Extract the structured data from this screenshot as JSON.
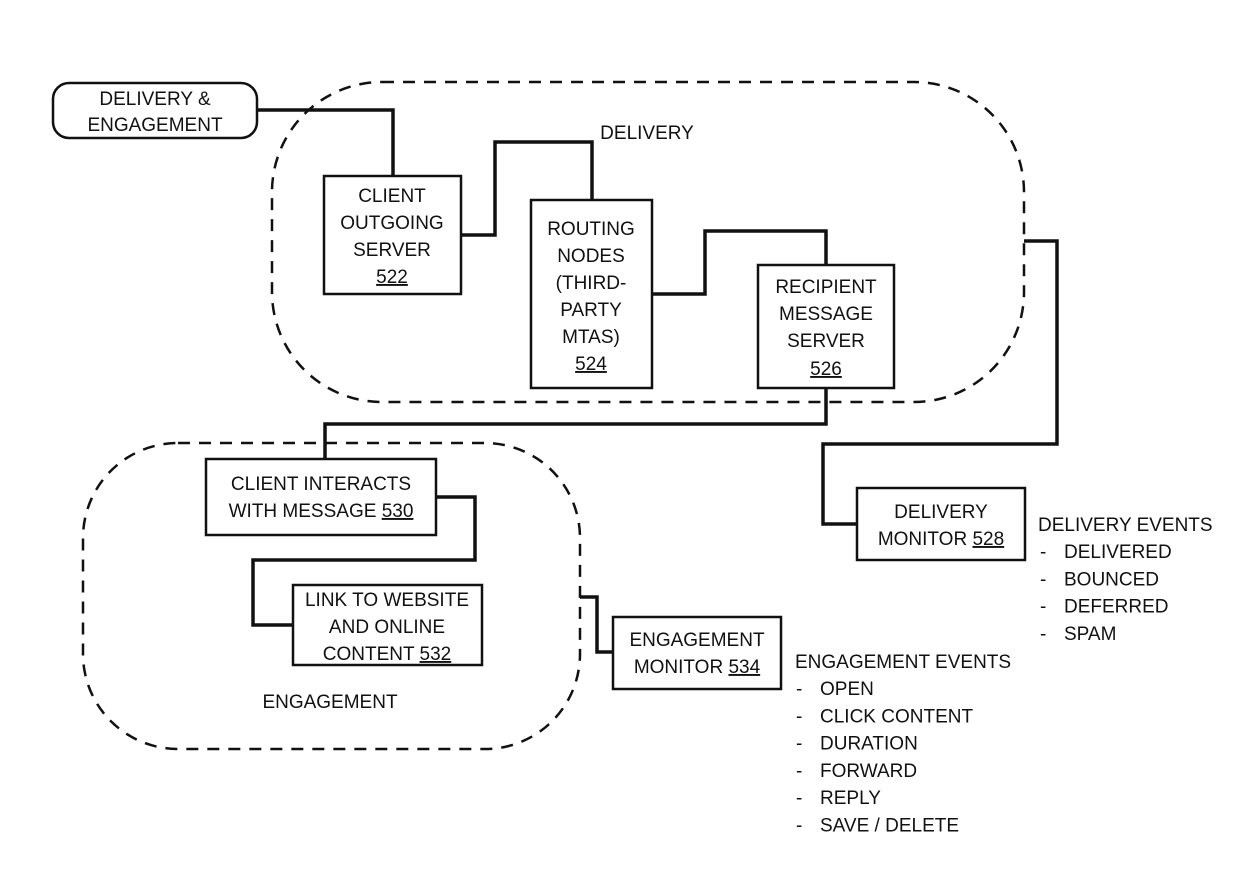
{
  "diagram": {
    "root": {
      "label_line1": "DELIVERY &",
      "label_line2": "ENGAGEMENT"
    },
    "regions": {
      "delivery": {
        "label": "DELIVERY"
      },
      "engagement": {
        "label": "ENGAGEMENT"
      }
    },
    "nodes": {
      "client_outgoing_server": {
        "lines": [
          "CLIENT",
          "OUTGOING",
          "SERVER"
        ],
        "ref": "522"
      },
      "routing_nodes": {
        "lines": [
          "ROUTING",
          "NODES",
          "(THIRD-",
          "PARTY",
          "MTAS)"
        ],
        "ref": "524"
      },
      "recipient_message_server": {
        "lines": [
          "RECIPIENT",
          "MESSAGE",
          "SERVER"
        ],
        "ref": "526"
      },
      "delivery_monitor": {
        "line1": "DELIVERY",
        "line2_prefix": "MONITOR ",
        "ref": "528"
      },
      "client_interacts": {
        "line1": "CLIENT INTERACTS",
        "line2_prefix": "WITH MESSAGE ",
        "ref": "530"
      },
      "link_to_website": {
        "line1": "LINK TO WEBSITE",
        "line2": "AND ONLINE",
        "line3_prefix": "CONTENT ",
        "ref": "532"
      },
      "engagement_monitor": {
        "line1": "ENGAGEMENT",
        "line2_prefix": "MONITOR ",
        "ref": "534"
      }
    },
    "delivery_events": {
      "title": "DELIVERY EVENTS",
      "bullet": "-",
      "items": [
        "DELIVERED",
        "BOUNCED",
        "DEFERRED",
        "SPAM"
      ]
    },
    "engagement_events": {
      "title": "ENGAGEMENT EVENTS",
      "bullet": "-",
      "items": [
        "OPEN",
        "CLICK CONTENT",
        "DURATION",
        "FORWARD",
        "REPLY",
        "SAVE / DELETE"
      ]
    }
  }
}
